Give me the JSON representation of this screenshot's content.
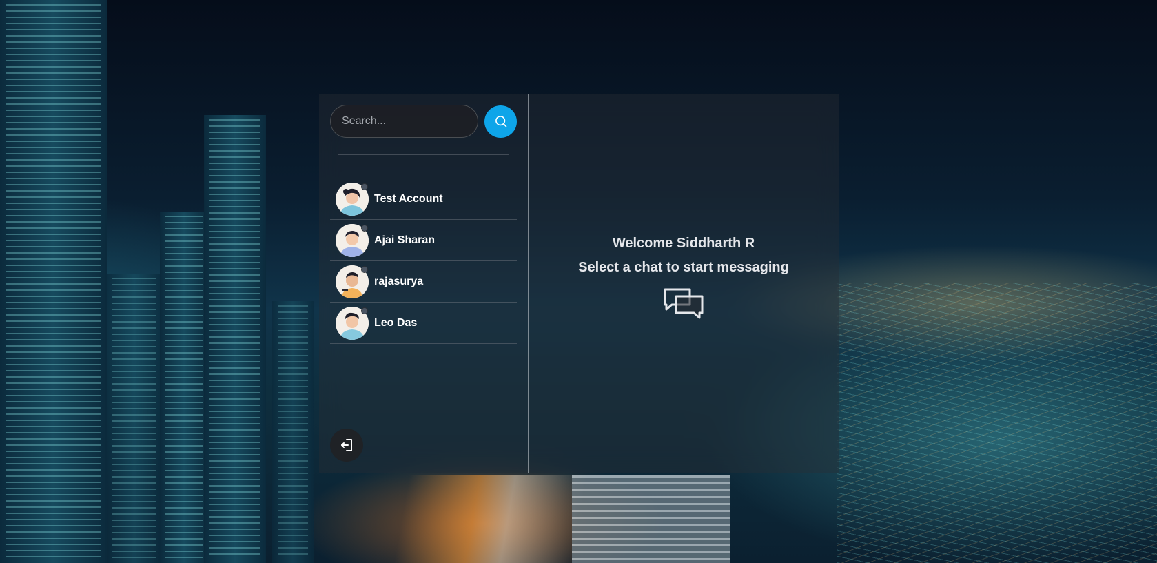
{
  "search": {
    "placeholder": "Search..."
  },
  "icons": {
    "search_button": "search-icon",
    "logout": "logout-icon",
    "empty_state": "chat-bubbles-icon"
  },
  "colors": {
    "accent": "#0ea5e9",
    "offline_dot": "#4b5563"
  },
  "conversations": [
    {
      "name": "Test Account"
    },
    {
      "name": "Ajai Sharan"
    },
    {
      "name": "rajasurya"
    },
    {
      "name": "Leo Das"
    }
  ],
  "welcome": {
    "line1": "Welcome Siddharth R",
    "line2": "Select a chat to start messaging"
  }
}
